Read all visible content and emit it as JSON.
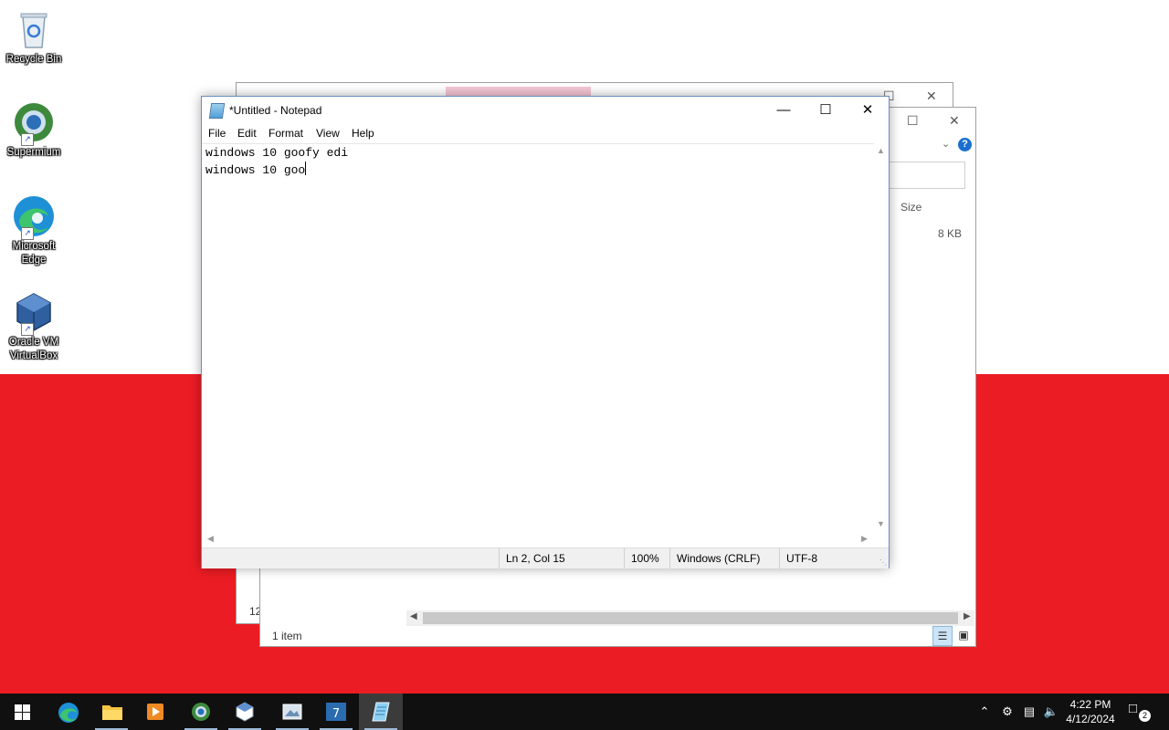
{
  "desktop": {
    "icons": [
      {
        "label": "Recycle Bin"
      },
      {
        "label": "Supermium"
      },
      {
        "label": "Microsoft Edge"
      },
      {
        "label": "Oracle VM VirtualBox"
      }
    ]
  },
  "explorer_back": {
    "footer_partial": "12"
  },
  "explorer_front": {
    "column_size": "Size",
    "row_size": "8 KB",
    "status_items": "1 item"
  },
  "notepad": {
    "title": "*Untitled - Notepad",
    "menu": [
      "File",
      "Edit",
      "Format",
      "View",
      "Help"
    ],
    "lines": [
      "windows 10 goofy edi",
      "windows 10 goo"
    ],
    "status": {
      "position": "Ln 2, Col 15",
      "zoom": "100%",
      "line_ending": "Windows (CRLF)",
      "encoding": "UTF-8"
    }
  },
  "taskbar": {
    "time": "4:22 PM",
    "date": "4/12/2024",
    "notification_count": "2"
  }
}
